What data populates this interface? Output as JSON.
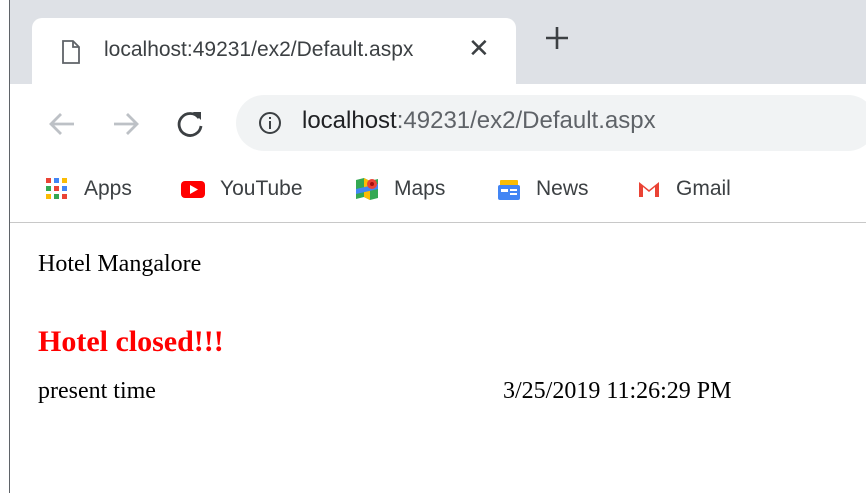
{
  "browser": {
    "tab": {
      "title": "localhost:49231/ex2/Default.aspx",
      "close_glyph": "✕"
    },
    "new_tab_icon": "plus-icon",
    "address_bar": {
      "host": "localhost",
      "path": ":49231/ex2/Default.aspx"
    },
    "nav_icons": [
      "back-arrow-icon",
      "forward-arrow-icon",
      "reload-icon"
    ],
    "bookmarks": [
      {
        "label": "Apps",
        "icon": "apps-grid-icon"
      },
      {
        "label": "YouTube",
        "icon": "youtube-icon"
      },
      {
        "label": "Maps",
        "icon": "maps-icon"
      },
      {
        "label": "News",
        "icon": "news-icon"
      },
      {
        "label": "Gmail",
        "icon": "gmail-icon"
      }
    ]
  },
  "page": {
    "hotel_name": "Hotel Mangalore",
    "status": "Hotel closed!!!",
    "status_color": "#ff0000",
    "time_label": "present time",
    "time_value": "3/25/2019 11:26:29 PM"
  }
}
